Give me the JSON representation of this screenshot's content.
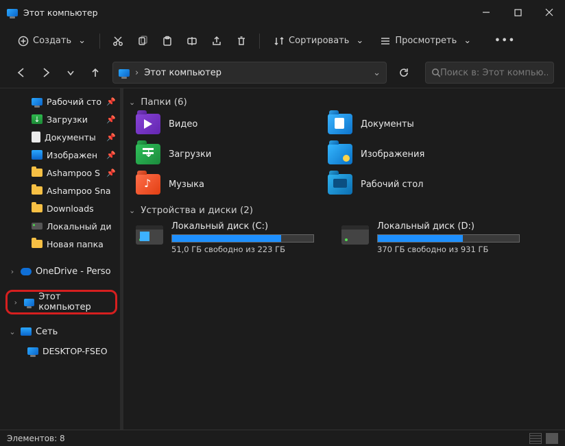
{
  "window": {
    "title": "Этот компьютер"
  },
  "toolbar": {
    "new_label": "Создать",
    "sort_label": "Сортировать",
    "view_label": "Просмотреть"
  },
  "address": {
    "location": "Этот компьютер",
    "separator": "›"
  },
  "search": {
    "placeholder": "Поиск в: Этот компью..."
  },
  "sidebar": {
    "quick": [
      {
        "label": "Рабочий сто",
        "icon": "monitor",
        "pinned": true
      },
      {
        "label": "Загрузки",
        "icon": "downloads",
        "pinned": true
      },
      {
        "label": "Документы",
        "icon": "doc",
        "pinned": true
      },
      {
        "label": "Изображен",
        "icon": "pic",
        "pinned": true
      },
      {
        "label": "Ashampoo S",
        "icon": "folder",
        "pinned": true
      },
      {
        "label": "Ashampoo Sna",
        "icon": "folder",
        "pinned": false
      },
      {
        "label": "Downloads",
        "icon": "folder",
        "pinned": false
      },
      {
        "label": "Локальный ди",
        "icon": "drive",
        "pinned": false
      },
      {
        "label": "Новая папка",
        "icon": "folder",
        "pinned": false
      }
    ],
    "onedrive": "OneDrive - Perso",
    "thispc": "Этот компьютер",
    "network": "Сеть",
    "network_child": "DESKTOP-FSEO"
  },
  "main": {
    "folders_header": "Папки (6)",
    "drives_header": "Устройства и диски (2)",
    "folders": [
      {
        "label": "Видео",
        "kind": "video"
      },
      {
        "label": "Документы",
        "kind": "docs"
      },
      {
        "label": "Загрузки",
        "kind": "down"
      },
      {
        "label": "Изображения",
        "kind": "pics"
      },
      {
        "label": "Музыка",
        "kind": "music"
      },
      {
        "label": "Рабочий стол",
        "kind": "desk"
      }
    ],
    "drives": [
      {
        "name": "Локальный диск (C:)",
        "free": "51,0 ГБ свободно из 223 ГБ",
        "fill_pct": 77
      },
      {
        "name": "Локальный диск (D:)",
        "free": "370 ГБ свободно из 931 ГБ",
        "fill_pct": 60
      }
    ]
  },
  "status": {
    "text": "Элементов: 8"
  }
}
